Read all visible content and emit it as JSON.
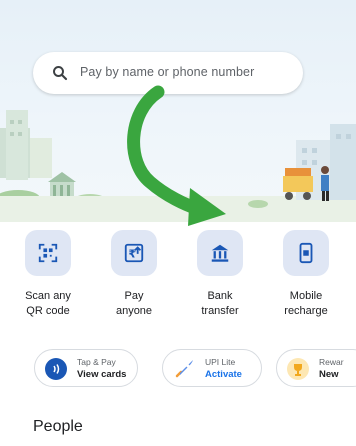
{
  "search": {
    "placeholder": "Pay by name or phone number",
    "icon": "search-icon"
  },
  "actions": [
    {
      "label": "Scan any\nQR code",
      "icon": "qr-code-icon"
    },
    {
      "label": "Pay\nanyone",
      "icon": "pay-anyone-icon"
    },
    {
      "label": "Bank\ntransfer",
      "icon": "bank-icon"
    },
    {
      "label": "Mobile\nrecharge",
      "icon": "mobile-icon"
    }
  ],
  "chips": [
    {
      "title": "Tap & Pay",
      "subtitle": "View cards",
      "icon": "contactless-icon"
    },
    {
      "title": "UPI Lite",
      "subtitle": "Activate",
      "icon": "rocket-icon"
    },
    {
      "title": "Rewar",
      "subtitle": "New",
      "icon": "trophy-icon"
    }
  ],
  "sections": {
    "people_title": "People"
  },
  "colors": {
    "accent_blue": "#1a73e8",
    "arrow_green": "#3aa63f",
    "tile_bg": "#dfe6f4"
  }
}
